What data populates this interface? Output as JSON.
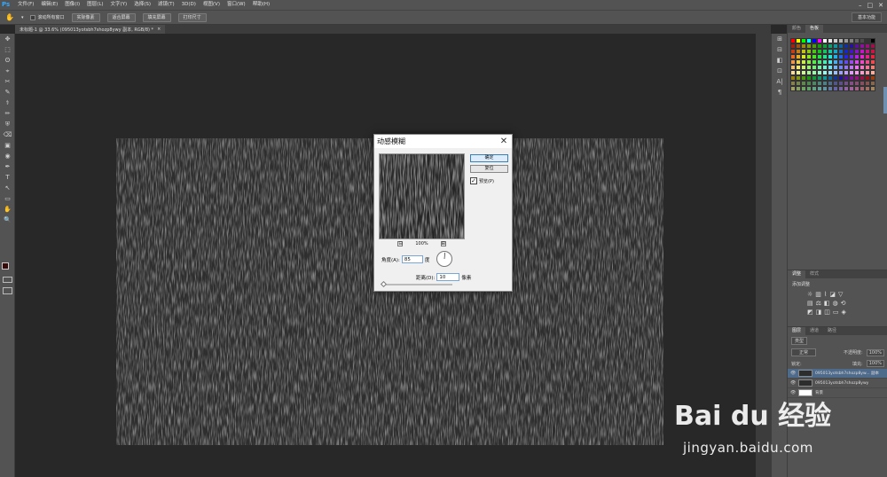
{
  "app": {
    "logo": "Ps"
  },
  "menu": [
    "文件(F)",
    "编辑(E)",
    "图像(I)",
    "图层(L)",
    "文字(Y)",
    "选择(S)",
    "滤镜(T)",
    "3D(D)",
    "视图(V)",
    "窗口(W)",
    "帮助(H)"
  ],
  "window_controls": {
    "minimize": "–",
    "maximize": "□",
    "close": "✕"
  },
  "options_bar": {
    "scroll_all_label": "滚动所有窗口",
    "buttons": [
      "实际像素",
      "适合屏幕",
      "填充屏幕",
      "打印尺寸"
    ],
    "workspace": "基本功能"
  },
  "doc_tab": {
    "title": "未标题-1 @ 33.6% (095013yotsbh7shozp8ywy 副本, RGB/8) *",
    "close": "×"
  },
  "tools": [
    "✥",
    "⬚",
    "ʘ",
    "⌖",
    "✂",
    "✎",
    "⚕",
    "✏",
    "⛨",
    "⌫",
    "▣",
    "◉",
    "✒",
    "T",
    "↖",
    "▭",
    "✋",
    "🔍"
  ],
  "dock_icons": [
    "⊞",
    "⊟",
    "◧",
    "⊡",
    "A|",
    "¶"
  ],
  "panels": {
    "swatch_tabs": [
      "颜色",
      "色板"
    ],
    "adjust_tabs": [
      "调整",
      "样式"
    ],
    "adjust_label": "添加调整",
    "layer_tabs": [
      "图层",
      "通道",
      "路径"
    ],
    "kind_label": "类型",
    "blend_mode": "正常",
    "opacity_label": "不透明度:",
    "opacity_value": "100%",
    "lock_label": "锁定:",
    "fill_label": "填充:",
    "fill_value": "100%",
    "layers": [
      {
        "name": "095013yotsbh7shozp8yw... 副本",
        "selected": true
      },
      {
        "name": "095013yotsbh7shozp8ywy",
        "selected": false
      },
      {
        "name": "背景",
        "selected": false
      }
    ]
  },
  "swatch_colors": [
    "#ff0000",
    "#ffff00",
    "#00ff00",
    "#00ffff",
    "#0000ff",
    "#ff00ff",
    "#ffffff",
    "#e6e6e6",
    "#cccccc",
    "#b3b3b3",
    "#999999",
    "#808080",
    "#666666",
    "#4d4d4d",
    "#333333",
    "#000000"
  ],
  "dialog": {
    "title": "动感模糊",
    "close": "✕",
    "ok": "确定",
    "reset": "复位",
    "preview_label": "预览(P)",
    "preview_checked": "✓",
    "zoom_out": "⊟",
    "zoom_in": "⊞",
    "zoom_percent": "100%",
    "angle_label": "角度(A):",
    "angle_value": "85",
    "angle_unit": "度",
    "distance_label": "距离(D):",
    "distance_value": "10",
    "distance_unit": "像素"
  },
  "watermark": {
    "brand": "Bai du 经验",
    "url": "jingyan.baidu.com"
  }
}
